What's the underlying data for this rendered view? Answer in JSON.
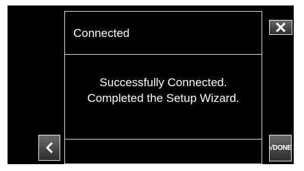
{
  "dialog": {
    "title": "Connected",
    "message_line1": "Successfully Connected.",
    "message_line2": "Completed the Setup Wizard."
  },
  "buttons": {
    "close_icon": "close-icon",
    "back_icon": "chevron-left-icon",
    "done_label": "√DONE"
  },
  "colors": {
    "background": "#000000",
    "border": "#d9d9d9",
    "text": "#ffffff",
    "button_top": "#6a6a6a",
    "button_bottom": "#2c2c2c"
  }
}
